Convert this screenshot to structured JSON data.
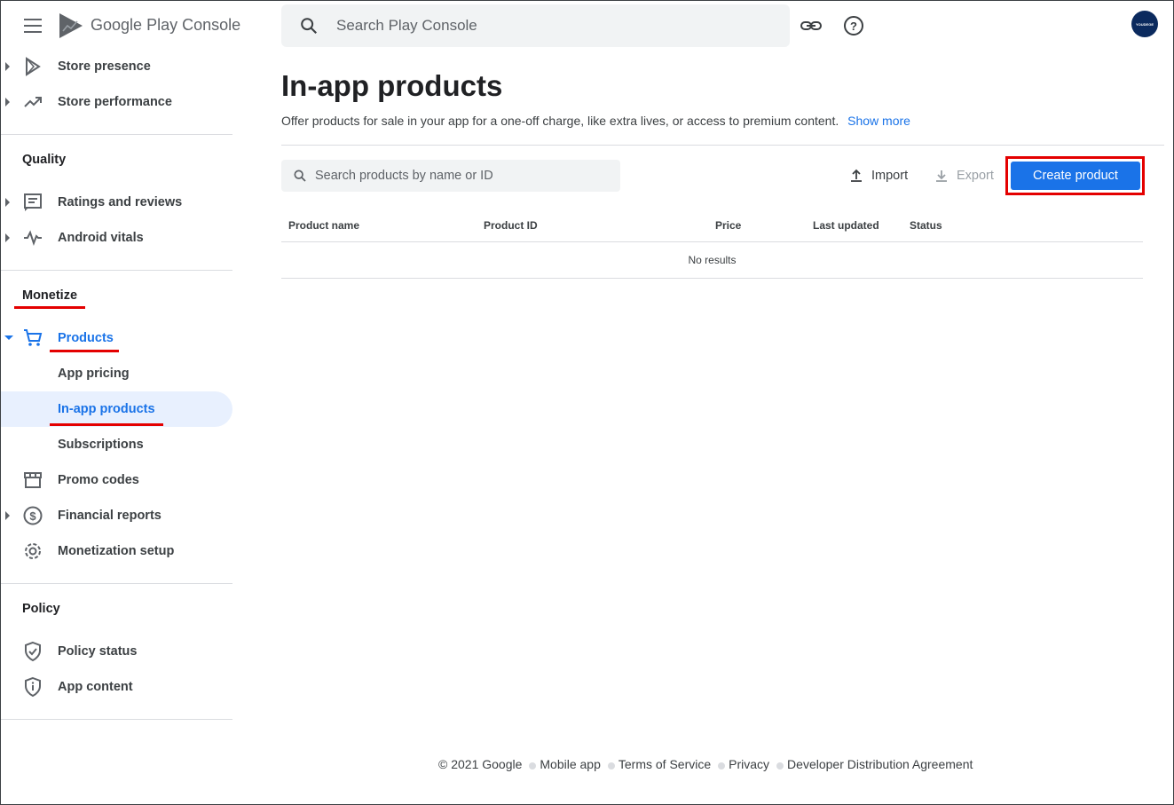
{
  "app": {
    "logo_google": "Google",
    "logo_play": "Play",
    "logo_console": "Console"
  },
  "topbar": {
    "search_placeholder": "Search Play Console",
    "avatar_text": "YOUDEGE"
  },
  "sidebar": {
    "top_items": [
      {
        "label": "Store presence"
      },
      {
        "label": "Store performance"
      }
    ],
    "quality": {
      "title": "Quality",
      "items": [
        {
          "label": "Ratings and reviews"
        },
        {
          "label": "Android vitals"
        }
      ]
    },
    "monetize": {
      "title": "Monetize",
      "products_label": "Products",
      "sub_items": [
        {
          "label": "App pricing"
        },
        {
          "label": "In-app products"
        },
        {
          "label": "Subscriptions"
        }
      ],
      "items": [
        {
          "label": "Promo codes"
        },
        {
          "label": "Financial reports"
        },
        {
          "label": "Monetization setup"
        }
      ]
    },
    "policy": {
      "title": "Policy",
      "items": [
        {
          "label": "Policy status"
        },
        {
          "label": "App content"
        }
      ]
    }
  },
  "main": {
    "title": "In-app products",
    "description": "Offer products for sale in your app for a one-off charge, like extra lives, or access to premium content.",
    "show_more": "Show more",
    "product_search_placeholder": "Search products by name or ID",
    "import_label": "Import",
    "export_label": "Export",
    "create_label": "Create product",
    "table": {
      "columns": [
        "Product name",
        "Product ID",
        "Price",
        "Last updated",
        "Status"
      ],
      "empty_text": "No results"
    }
  },
  "footer": {
    "copyright": "© 2021 Google",
    "links": [
      "Mobile app",
      "Terms of Service",
      "Privacy",
      "Developer Distribution Agreement"
    ]
  },
  "colors": {
    "accent": "#1a73e8",
    "highlight": "#e40000",
    "selected_bg": "#e8f0fe"
  }
}
